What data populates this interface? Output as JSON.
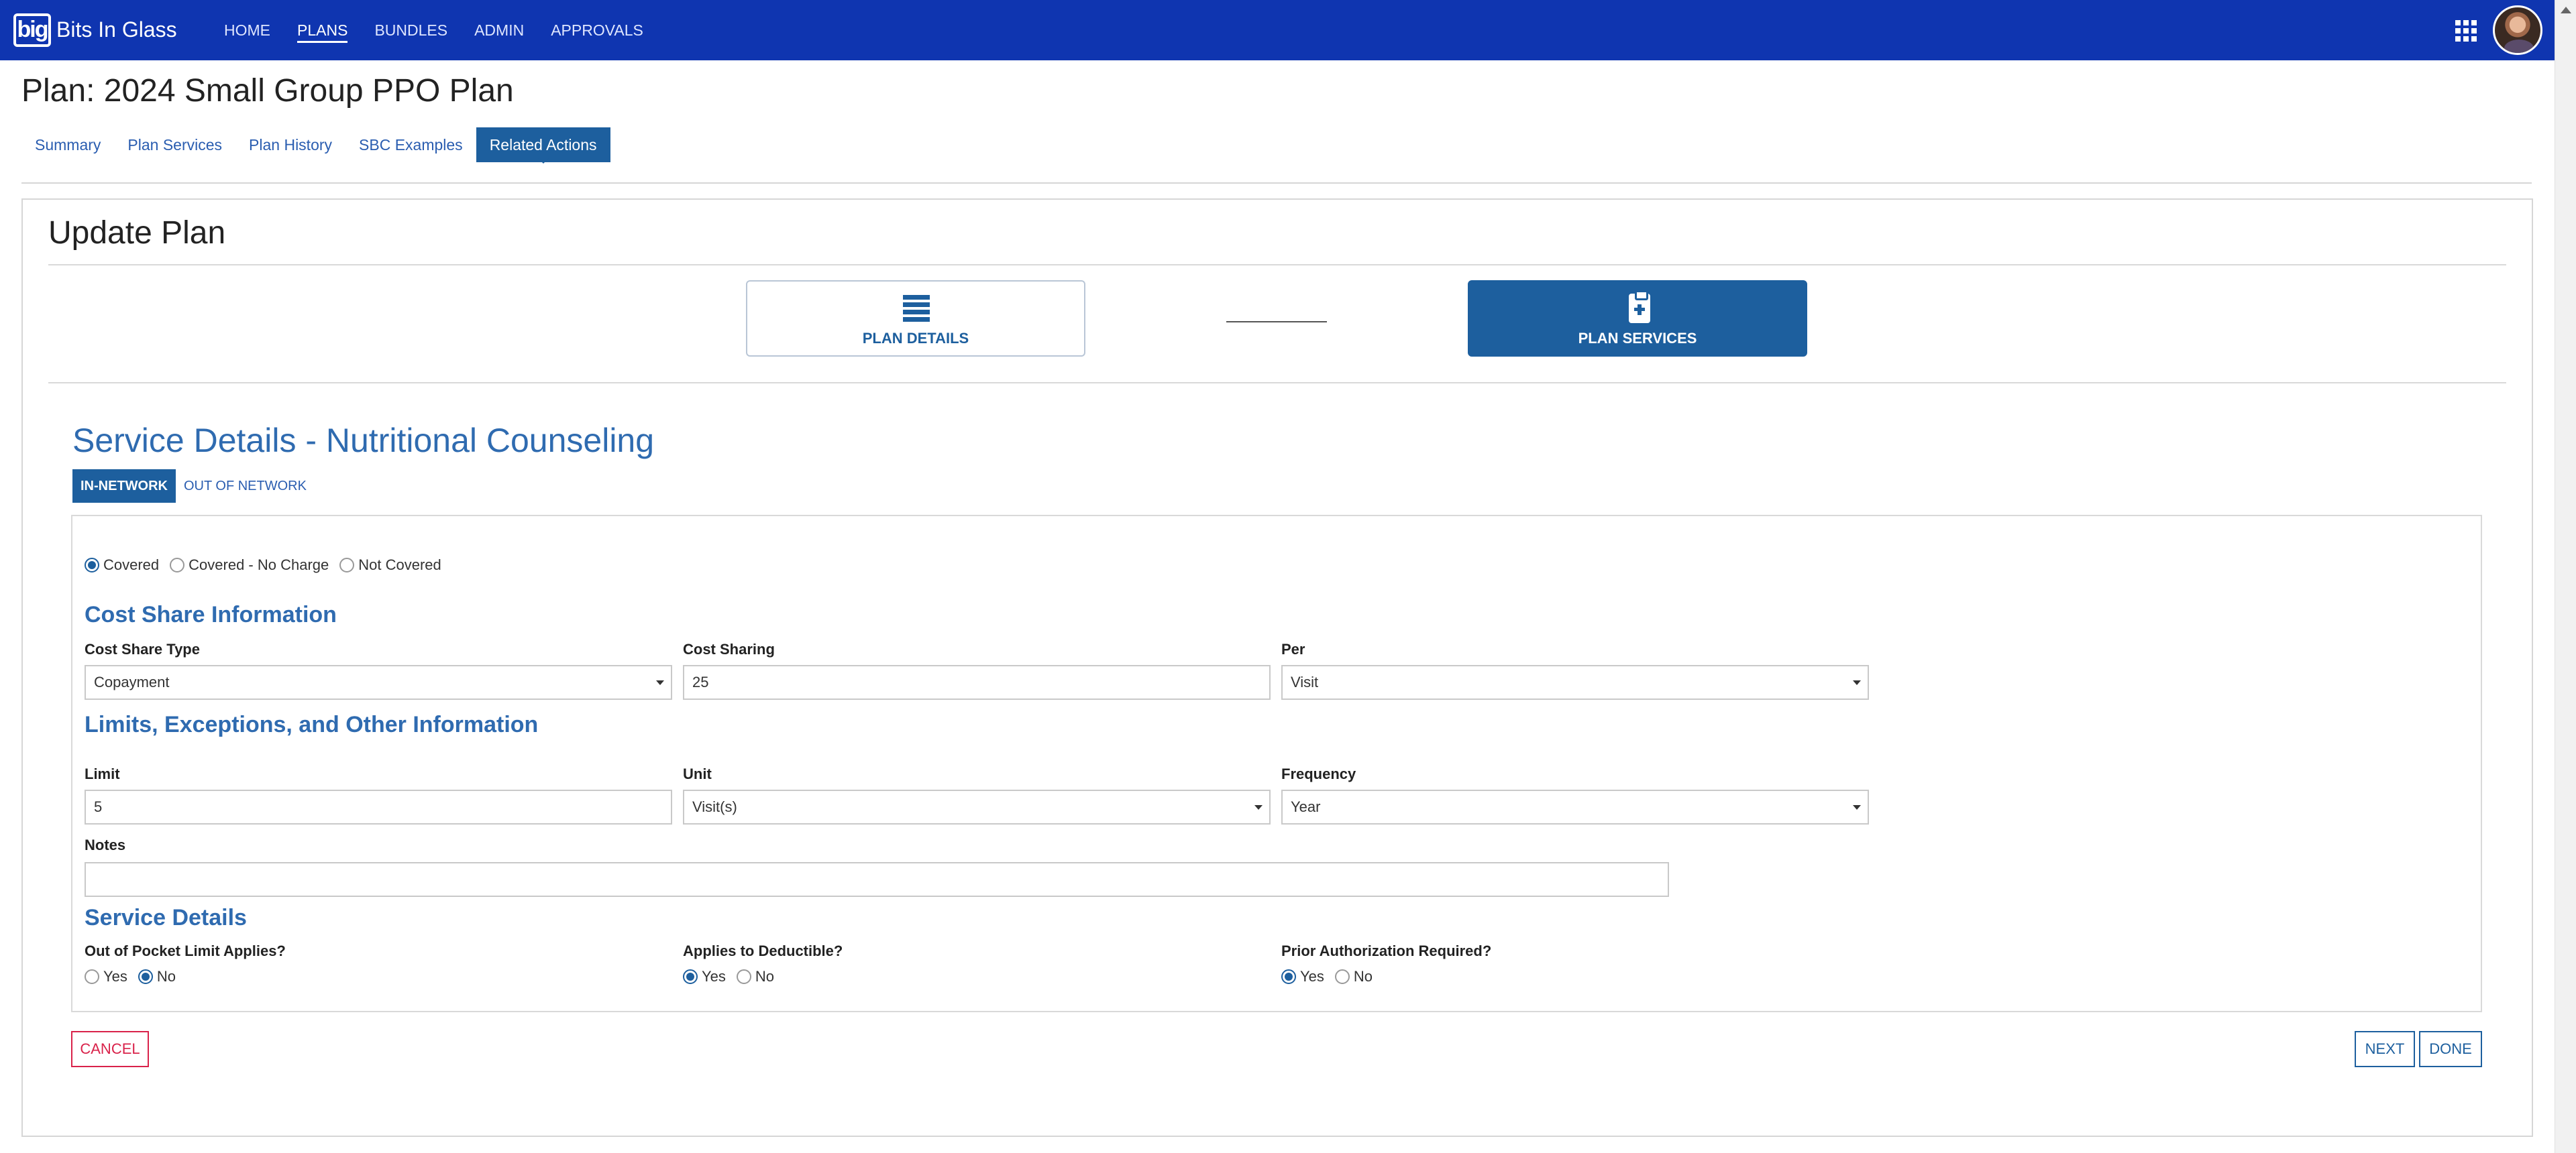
{
  "app": {
    "logo_mark": "big",
    "name": "Bits In Glass"
  },
  "nav": {
    "items": [
      "HOME",
      "PLANS",
      "BUNDLES",
      "ADMIN",
      "APPROVALS"
    ],
    "active": "PLANS"
  },
  "header": {
    "icons": [
      "apps-grid-icon",
      "user-avatar"
    ]
  },
  "page": {
    "title": "Plan: 2024 Small Group PPO Plan",
    "tabs": [
      "Summary",
      "Plan Services",
      "Plan History",
      "SBC Examples",
      "Related Actions"
    ],
    "active_tab": "Related Actions"
  },
  "form": {
    "title": "Update Plan",
    "steps": [
      {
        "label": "PLAN DETAILS",
        "icon": "list-icon",
        "active": false
      },
      {
        "label": "PLAN SERVICES",
        "icon": "clipboard-plus-icon",
        "active": true
      }
    ],
    "service_title": "Service Details - Nutritional Counseling",
    "network_tabs": [
      "IN-NETWORK",
      "OUT OF NETWORK"
    ],
    "active_network_tab": "IN-NETWORK",
    "coverage": {
      "options": [
        "Covered",
        "Covered - No Charge",
        "Not Covered"
      ],
      "selected": "Covered"
    },
    "cost_share": {
      "heading": "Cost Share Information",
      "type_label": "Cost Share Type",
      "type_value": "Copayment",
      "sharing_label": "Cost Sharing",
      "sharing_value": "25",
      "per_label": "Per",
      "per_value": "Visit"
    },
    "limits": {
      "heading": "Limits, Exceptions, and Other Information",
      "limit_label": "Limit",
      "limit_value": "5",
      "unit_label": "Unit",
      "unit_value": "Visit(s)",
      "frequency_label": "Frequency",
      "frequency_value": "Year",
      "notes_label": "Notes",
      "notes_value": ""
    },
    "service_details": {
      "heading": "Service Details",
      "oop_label": "Out of Pocket Limit Applies?",
      "oop_selected": "No",
      "deductible_label": "Applies to Deductible?",
      "deductible_selected": "Yes",
      "prior_auth_label": "Prior Authorization Required?",
      "prior_auth_selected": "Yes",
      "yes": "Yes",
      "no": "No"
    },
    "buttons": {
      "cancel": "CANCEL",
      "next": "NEXT",
      "done": "DONE"
    }
  }
}
